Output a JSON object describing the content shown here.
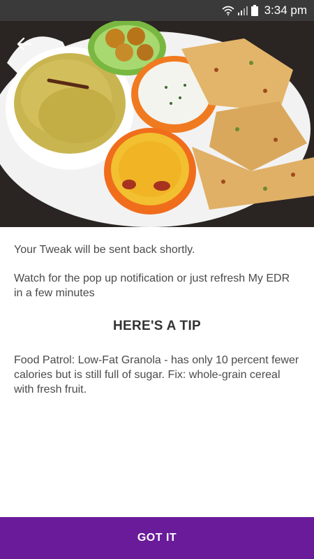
{
  "status_bar": {
    "time": "3:34 pm",
    "icons": [
      "wifi-icon",
      "signal-icon",
      "battery-icon"
    ]
  },
  "hero": {
    "image": "food-plate-image",
    "back_icon": "back-arrow-icon"
  },
  "message": {
    "line1": "Your Tweak will be sent back shortly.",
    "line2": "Watch for the pop up notification or just refresh My EDR in a few minutes"
  },
  "tip": {
    "heading": "HERE'S A TIP",
    "text": "Food Patrol: Low-Fat Granola - has only 10 percent fewer calories but is still full of sugar. Fix: whole-grain cereal with fresh fruit."
  },
  "footer": {
    "button_label": "GOT IT",
    "button_color": "#6a1b9a"
  }
}
